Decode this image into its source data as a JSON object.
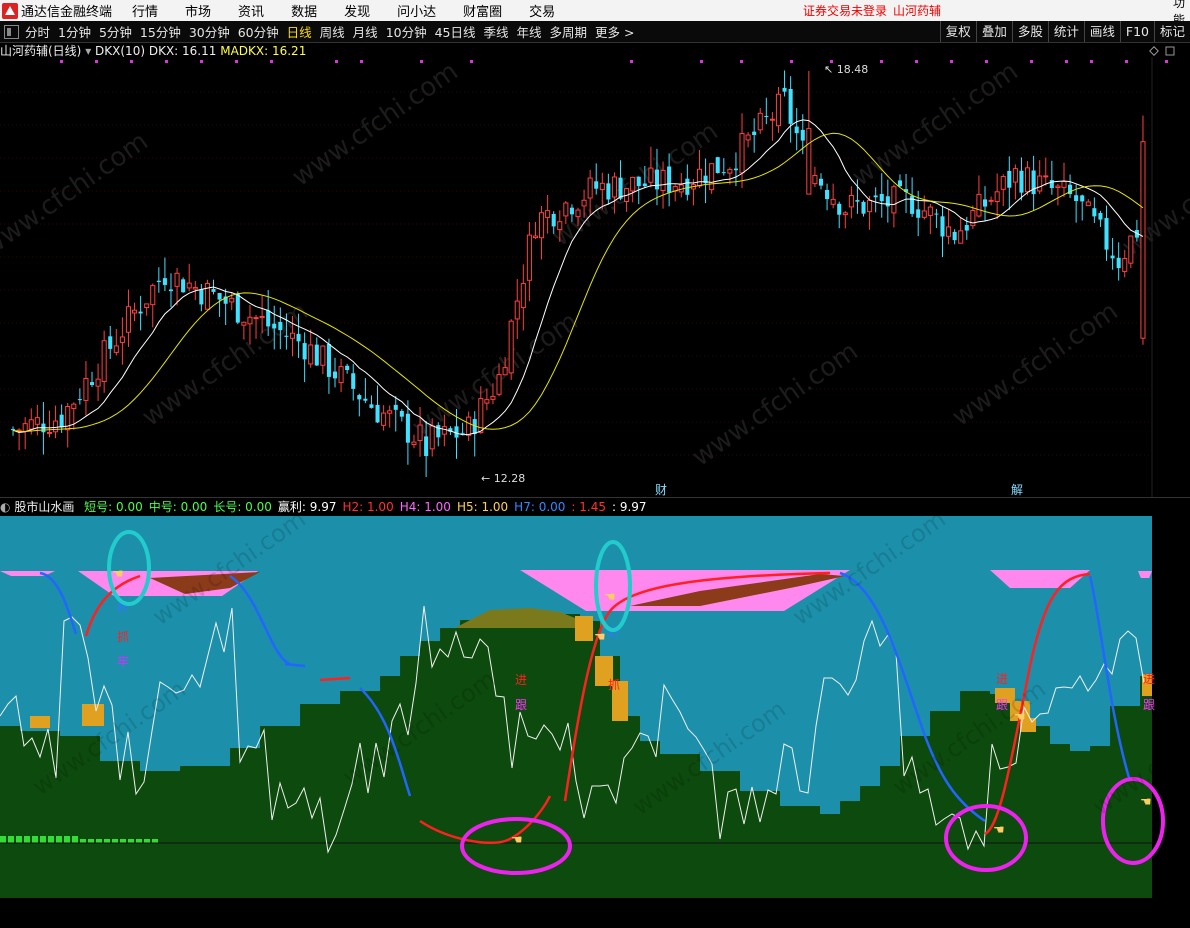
{
  "app": {
    "title": "通达信金融终端",
    "menu": [
      "行情",
      "市场",
      "资讯",
      "数据",
      "发现",
      "问小达",
      "财富圈",
      "交易"
    ],
    "warning": "证券交易未登录",
    "stock_name": "山河药辅",
    "func_label": "功能"
  },
  "periods": [
    "分时",
    "1分钟",
    "5分钟",
    "15分钟",
    "30分钟",
    "60分钟",
    "日线",
    "周线",
    "月线",
    "10分钟",
    "45日线",
    "季线",
    "年线",
    "多周期",
    "更多 >"
  ],
  "active_period": "日线",
  "right_tools": [
    "复权",
    "叠加",
    "多股",
    "统计",
    "画线",
    "F10",
    "标记"
  ],
  "main_header": {
    "title": "山河药辅(日线)",
    "indicator": "DKX(10)",
    "dkx": "DKX: 16.11",
    "madkx": "MADKX: 16.21"
  },
  "main_labels": {
    "high": "18.48",
    "low": "12.28",
    "marker1": "财",
    "marker2": "解"
  },
  "sub_header": {
    "title": "股市山水画",
    "items": [
      {
        "label": "短号:",
        "value": "0.00",
        "color": "#4cff4c"
      },
      {
        "label": "中号:",
        "value": "0.00",
        "color": "#4cff4c"
      },
      {
        "label": "长号:",
        "value": "0.00",
        "color": "#4cff4c"
      },
      {
        "label": "赢利:",
        "value": "9.97",
        "color": "#ffffff"
      },
      {
        "label": "H2:",
        "value": "1.00",
        "color": "#ff3030"
      },
      {
        "label": "H4:",
        "value": "1.00",
        "color": "#ff66ff"
      },
      {
        "label": "H5:",
        "value": "1.00",
        "color": "#ffd24c"
      },
      {
        "label": "H7:",
        "value": "0.00",
        "color": "#3388ff"
      },
      {
        "label": ":",
        "value": "1.45",
        "color": "#ff3030"
      },
      {
        "label": ":",
        "value": "9.97",
        "color": "#ffffff"
      }
    ]
  },
  "sub_labels": [
    {
      "text": "好",
      "color": "#3377ff"
    },
    {
      "text": "抓",
      "color": "#ff2020"
    },
    {
      "text": "牢",
      "color": "#cc33ff"
    },
    {
      "text": "进",
      "color": "#ff2020"
    },
    {
      "text": "跟",
      "color": "#ff33ff"
    },
    {
      "text": "好",
      "color": "#3377ff"
    },
    {
      "text": "抓",
      "color": "#ff2020"
    },
    {
      "text": "进",
      "color": "#ff2020"
    },
    {
      "text": "跟",
      "color": "#ff33ff"
    },
    {
      "text": "进",
      "color": "#ff2020"
    },
    {
      "text": "跟",
      "color": "#ff33ff"
    }
  ],
  "watermark": "www.cfchi.com",
  "colors": {
    "up": "#ff4040",
    "down": "#40e0ff",
    "dkx": "#ffffff",
    "madkx": "#e6e600",
    "sky": "#1c90aa",
    "mountain": "#0d4a0d",
    "pink": "#ff88ee",
    "circle_cyan": "#22cccc",
    "circle_mag": "#ee22ee"
  }
}
